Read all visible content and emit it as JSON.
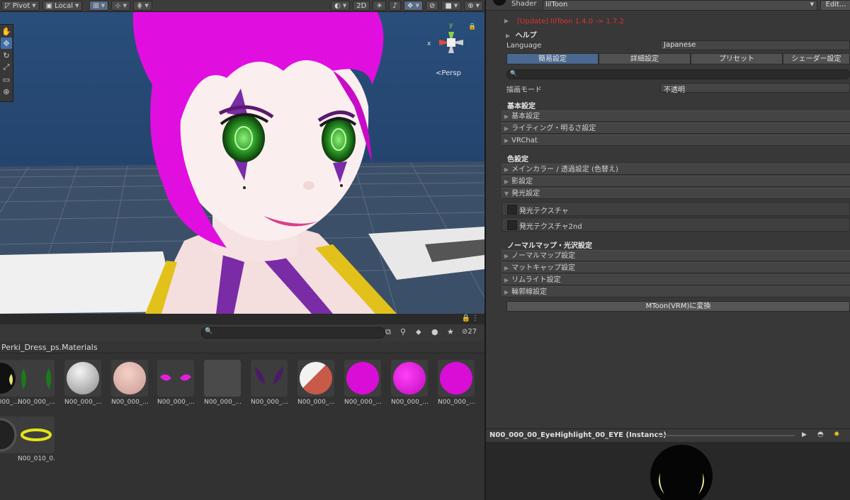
{
  "scene": {
    "toolbar": {
      "pivot_label": "Pivot",
      "local_label": "Local",
      "mode_2d_label": "2D"
    },
    "gizmo": {
      "axis_y": "y",
      "axis_x": "x",
      "persp_label": "Persp"
    }
  },
  "project": {
    "hidden_count": "27",
    "breadcrumb": "Perki_Dress_ps.Materials",
    "thumbnails": [
      {
        "label": "N00_000_..."
      },
      {
        "label": "N00_000_..."
      },
      {
        "label": "N00_000_..."
      },
      {
        "label": "N00_000_..."
      },
      {
        "label": "N00_000_..."
      },
      {
        "label": "N00_000_..."
      },
      {
        "label": "N00_000_..."
      },
      {
        "label": "N00_000_..."
      },
      {
        "label": "N00_000_..."
      },
      {
        "label": "N00_000_..."
      },
      {
        "label": "N00_010_0..."
      }
    ]
  },
  "inspector": {
    "shader_label": "Shader",
    "shader_value": "lilToon",
    "edit_button": "Edit...",
    "update_notice": "[Update] lilToon 1.4.0 -> 1.7.2",
    "help_label": "ヘルプ",
    "language_label": "Language",
    "language_value": "Japanese",
    "tabs": [
      "簡易設定",
      "詳細設定",
      "プリセット",
      "シェーダー設定"
    ],
    "render_mode_label": "描画モード",
    "render_mode_value": "不透明",
    "basic_header": "基本設定",
    "basic_items": [
      "基本設定",
      "ライティング・明るさ設定",
      "VRChat"
    ],
    "color_header": "色設定",
    "color_items": [
      "メインカラー / 透過設定 (色替え)",
      "影設定",
      "発光設定"
    ],
    "emission_items": [
      "発光テクスチャ",
      "発光テクスチャ2nd"
    ],
    "normal_header": "ノーマルマップ・光沢設定",
    "normal_items": [
      "ノーマルマップ設定",
      "マットキャップ設定",
      "リムライト設定",
      "輪郭線設定"
    ],
    "convert_button": "MToon(VRM)に変換",
    "preview_title": "N00_000_00_EyeHighlight_00_EYE (Instance)"
  },
  "colors": {
    "accent": "#3f6fa8",
    "tab_selected": "#4b6890",
    "warning": "#e03030",
    "hair": "#e10ee0",
    "eye": "#2d9c25",
    "scene_bg": "#1b3a63"
  }
}
